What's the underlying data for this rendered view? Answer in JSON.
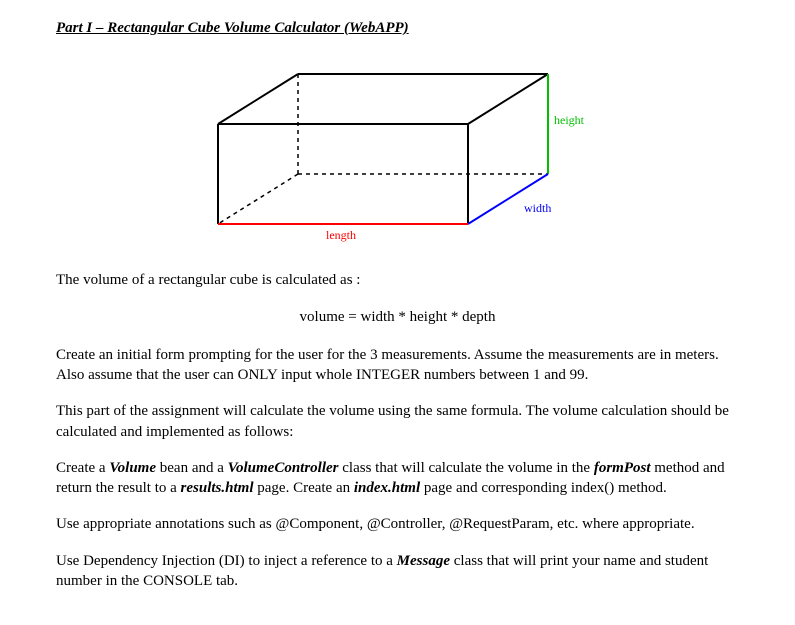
{
  "title": "Part I – Rectangular Cube Volume Calculator (WebAPP)",
  "diagram": {
    "label_height": "height",
    "label_width": "width",
    "label_length": "length",
    "colors": {
      "height": "#00c000",
      "width": "#0000ff",
      "length": "#ff0000",
      "edge": "#000000",
      "hidden": "#000000"
    }
  },
  "p1": "The volume of a rectangular cube is calculated as :",
  "formula": "volume = width * height * depth",
  "p2": "Create an initial form prompting for the user for the 3 measurements. Assume the measurements are in meters. Also assume that the user can ONLY input whole INTEGER numbers between 1 and 99.",
  "p3": "This part of the assignment will calculate the volume using the same formula. The volume calculation should be calculated and implemented as follows:",
  "p4": {
    "prefix": "Create a ",
    "volume": "Volume",
    "mid1": " bean and a ",
    "volumeController": "VolumeController",
    "mid2": " class that will calculate the volume in the ",
    "formPost": "formPost",
    "mid3": " method and return the result to a ",
    "resultsHtml": "results.html",
    "mid4": " page. Create an ",
    "indexHtml": "index.html",
    "suffix": " page and corresponding index() method."
  },
  "p5": "Use appropriate annotations such as @Component, @Controller, @RequestParam, etc. where appropriate.",
  "p6": {
    "prefix": "Use Dependency Injection (DI) to inject a reference to a ",
    "message": "Message",
    "suffix": " class that will print your name and student number in the CONSOLE tab."
  }
}
